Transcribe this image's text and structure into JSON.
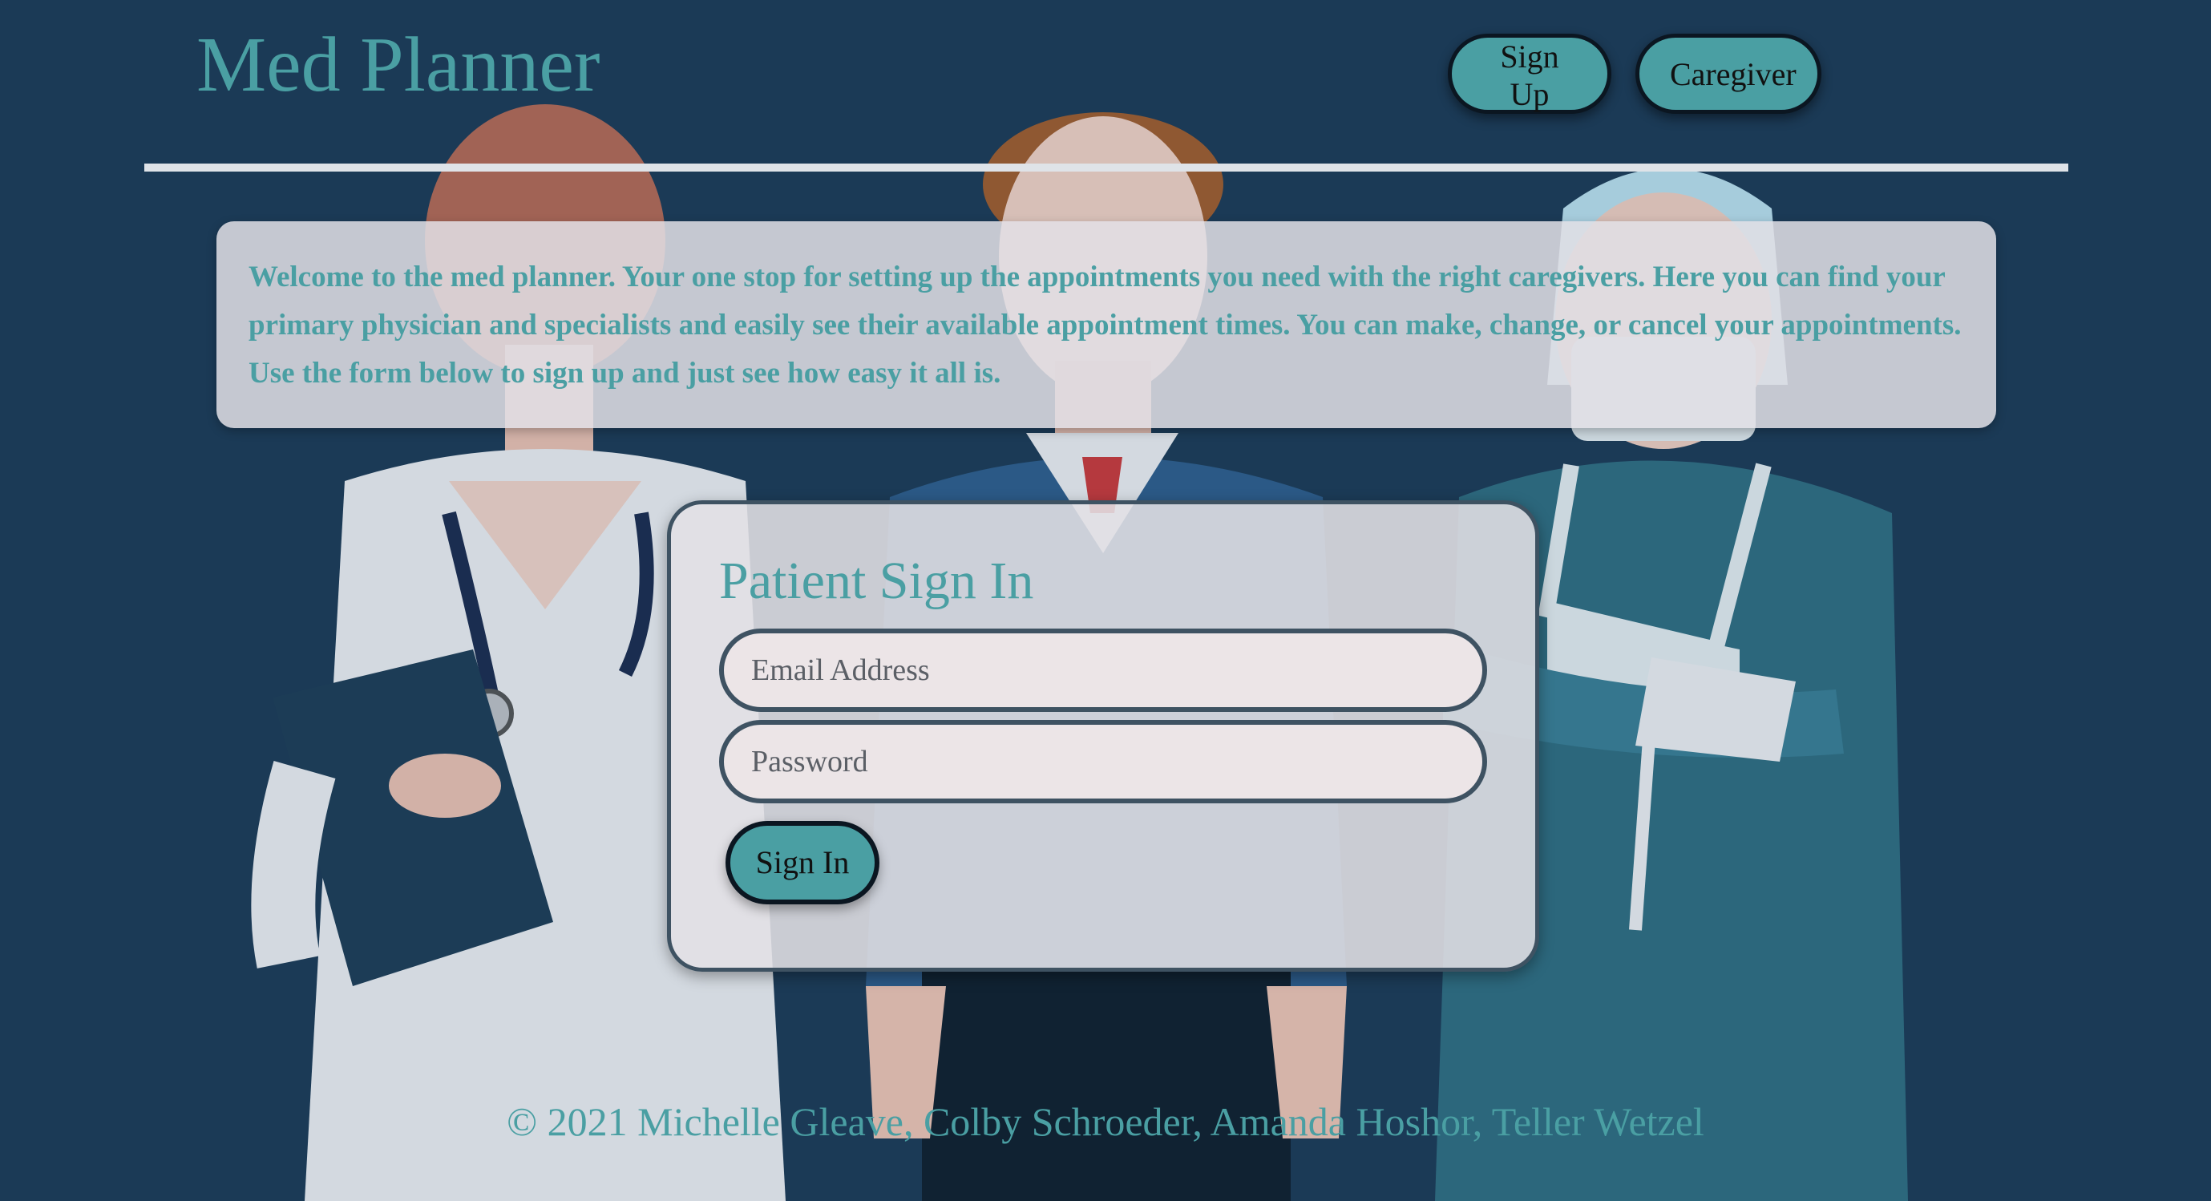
{
  "header": {
    "title": "Med Planner",
    "nav": {
      "signup_label": "Sign Up",
      "caregiver_label": "Caregiver"
    }
  },
  "welcome": {
    "text": "Welcome to the med planner. Your one stop for setting up the appointments you need with the right caregivers. Here you can find your primary physician and specialists and easily see their available appointment times. You can make, change, or cancel your appointments. Use the form below to sign up and just see how easy it all is."
  },
  "signin": {
    "title": "Patient Sign In",
    "email_placeholder": "Email Address",
    "email_value": "",
    "password_placeholder": "Password",
    "password_value": "",
    "button_label": "Sign In"
  },
  "footer": {
    "text": "© 2021 Michelle Gleave, Colby Schroeder, Amanda Hoshor, Teller Wetzel"
  },
  "colors": {
    "background": "#1c3a56",
    "accent": "#4a9fa3",
    "panel": "#e2e0e5",
    "border": "#3e5262"
  }
}
